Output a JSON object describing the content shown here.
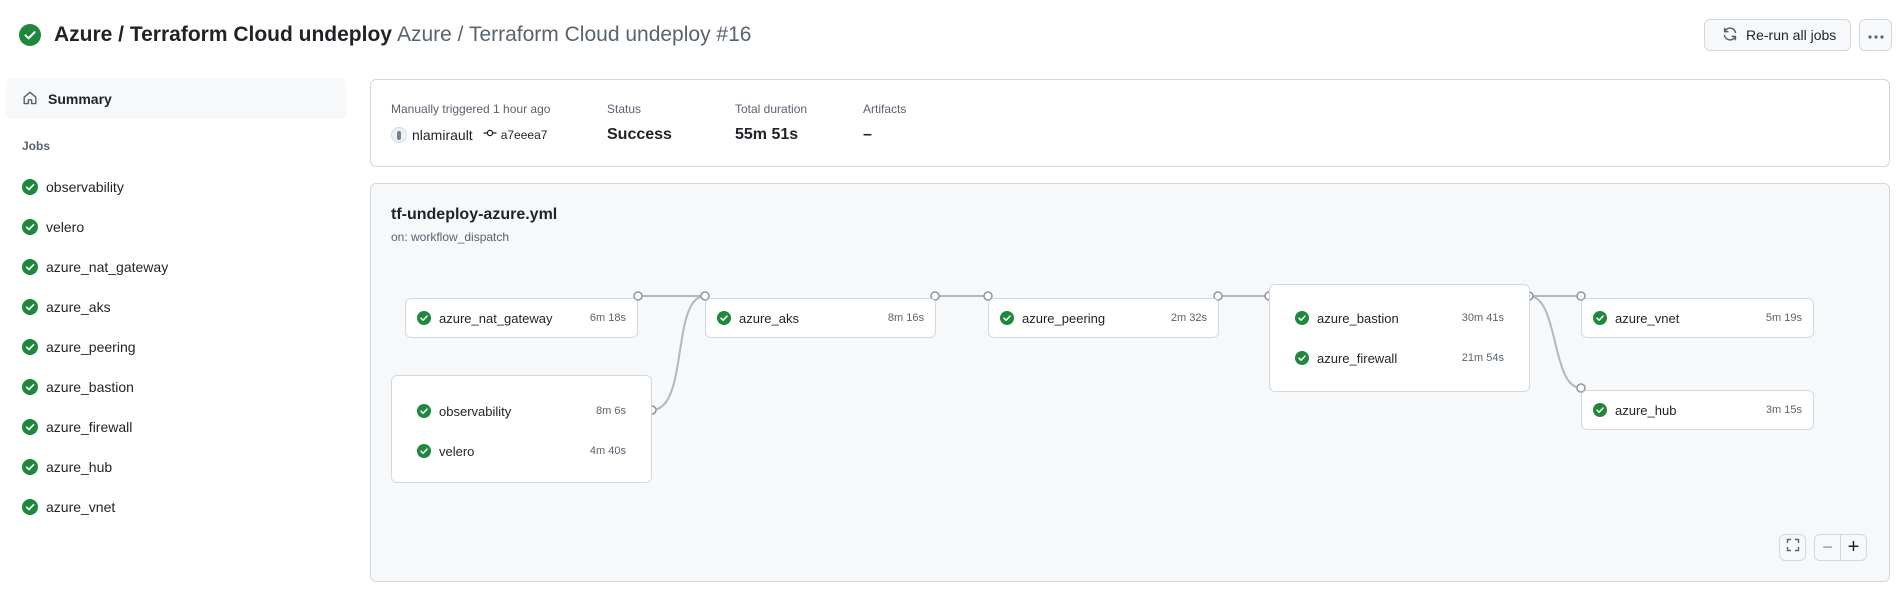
{
  "header": {
    "workflow_title": "Azure / Terraform Cloud undeploy",
    "run_title": "Azure / Terraform Cloud undeploy #16",
    "rerun_label": "Re-run all jobs",
    "more_label": "···"
  },
  "sidebar": {
    "summary_label": "Summary",
    "jobs_heading": "Jobs",
    "jobs": [
      {
        "label": "observability"
      },
      {
        "label": "velero"
      },
      {
        "label": "azure_nat_gateway"
      },
      {
        "label": "azure_aks"
      },
      {
        "label": "azure_peering"
      },
      {
        "label": "azure_bastion"
      },
      {
        "label": "azure_firewall"
      },
      {
        "label": "azure_hub"
      },
      {
        "label": "azure_vnet"
      }
    ]
  },
  "summary_card": {
    "trigger_label": "Manually triggered 1 hour ago",
    "actor": "nlamirault",
    "commit": "a7eeea7",
    "status_label": "Status",
    "status_value": "Success",
    "duration_label": "Total duration",
    "duration_value": "55m 51s",
    "artifacts_label": "Artifacts",
    "artifacts_value": "–"
  },
  "workflow": {
    "file": "tf-undeploy-azure.yml",
    "trigger": "on: workflow_dispatch",
    "nodes": {
      "nat_gateway": {
        "name": "azure_nat_gateway",
        "duration": "6m 18s"
      },
      "observability": {
        "name": "observability",
        "duration": "8m 6s"
      },
      "velero": {
        "name": "velero",
        "duration": "4m 40s"
      },
      "aks": {
        "name": "azure_aks",
        "duration": "8m 16s"
      },
      "peering": {
        "name": "azure_peering",
        "duration": "2m 32s"
      },
      "bastion": {
        "name": "azure_bastion",
        "duration": "30m 41s"
      },
      "firewall": {
        "name": "azure_firewall",
        "duration": "21m 54s"
      },
      "vnet": {
        "name": "azure_vnet",
        "duration": "5m 19s"
      },
      "hub": {
        "name": "azure_hub",
        "duration": "3m 15s"
      }
    },
    "zoom_out_label": "−",
    "zoom_in_label": "+"
  },
  "colors": {
    "success": "#1f883d",
    "border": "#d1d9e0",
    "muted_text": "#59636e",
    "panel_bg": "#f6f8fa"
  },
  "icons": {
    "status": "check-circle-fill-icon",
    "rerun": "sync-icon",
    "summary": "home-icon",
    "commit": "git-commit-icon",
    "fullscreen": "screen-full-icon"
  }
}
